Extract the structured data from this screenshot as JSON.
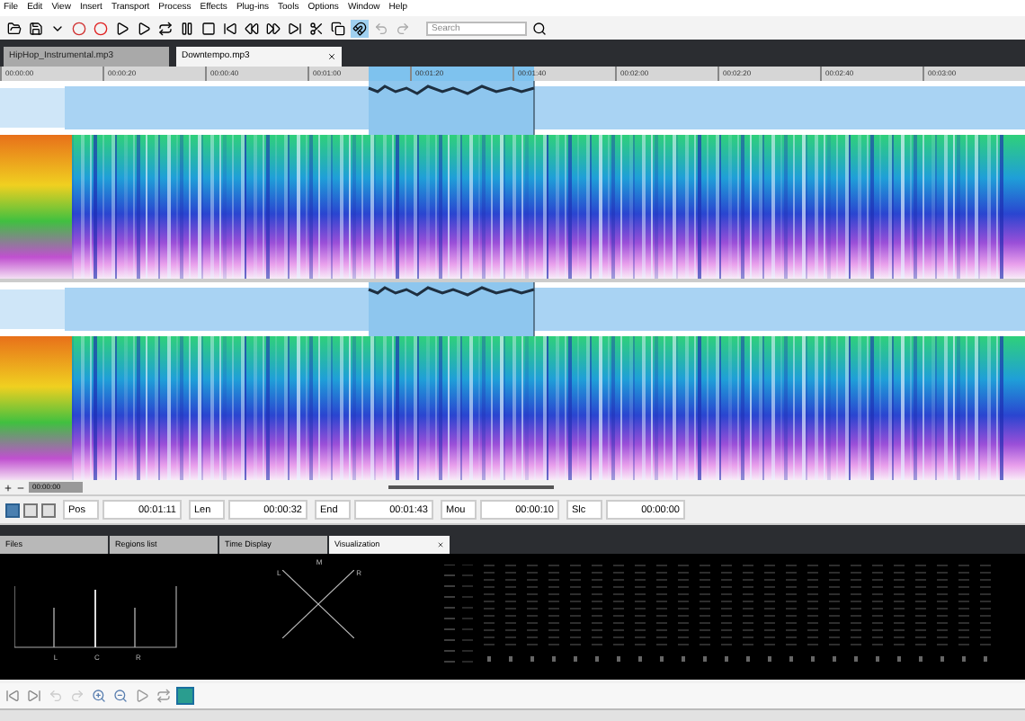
{
  "menu": [
    "File",
    "Edit",
    "View",
    "Insert",
    "Transport",
    "Process",
    "Effects",
    "Plug-ins",
    "Tools",
    "Options",
    "Window",
    "Help"
  ],
  "toolbar": {
    "snap_on": true
  },
  "search": {
    "placeholder": "Search"
  },
  "file_tabs": [
    {
      "label": "HipHop_Instrumental.mp3",
      "selected": false
    },
    {
      "label": "Downtempo.mp3",
      "selected": true
    }
  ],
  "ruler": [
    "00:00:00",
    "00:00:20",
    "00:00:40",
    "00:01:00",
    "00:01:20",
    "00:01:40",
    "00:02:00",
    "00:02:20",
    "00:02:40",
    "00:03:00"
  ],
  "scroll": {
    "position": "00:00:00"
  },
  "view_modes": [
    {
      "selected": true
    },
    {
      "selected": false
    },
    {
      "selected": false
    }
  ],
  "status": [
    {
      "label": "Pos",
      "value": "00:01:11"
    },
    {
      "label": "Len",
      "value": "00:00:32"
    },
    {
      "label": "End",
      "value": "00:01:43"
    },
    {
      "label": "Mou",
      "value": "00:00:10"
    },
    {
      "label": "Slc",
      "value": "00:00:00"
    }
  ],
  "panel_tabs": [
    {
      "label": "Files",
      "selected": false
    },
    {
      "label": "Regions list",
      "selected": false
    },
    {
      "label": "Time Display",
      "selected": false
    },
    {
      "label": "Visualization",
      "selected": true
    }
  ],
  "visualization": {
    "analyzer_labels": [
      "L",
      "C",
      "R"
    ],
    "scope_top": "M",
    "scope_left": "L",
    "scope_right": "R"
  },
  "bottom_toolbar": {
    "visualization_on": true
  }
}
